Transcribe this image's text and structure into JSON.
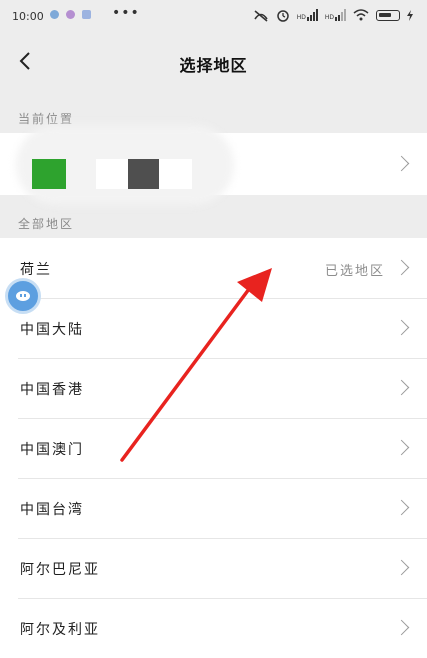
{
  "status_bar": {
    "time": "10:00",
    "more": "•••",
    "hd_tag": "HD"
  },
  "nav": {
    "title": "选择地区"
  },
  "current_location": {
    "header": "当前位置"
  },
  "all_regions": {
    "header": "全部地区",
    "items": [
      {
        "name": "荷兰",
        "status": "已选地区"
      },
      {
        "name": "中国大陆"
      },
      {
        "name": "中国香港"
      },
      {
        "name": "中国澳门"
      },
      {
        "name": "中国台湾"
      },
      {
        "name": "阿尔巴尼亚"
      },
      {
        "name": "阿尔及利亚"
      }
    ]
  },
  "colors": {
    "annotation_arrow": "#e8231f",
    "location_green": "#2ea32e",
    "location_gray": "#4f4f4f",
    "bubble_blue": "#5d9fe0"
  }
}
